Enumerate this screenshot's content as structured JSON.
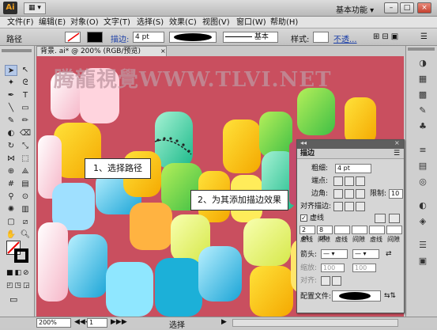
{
  "titlebar": {
    "app_logo": "Ai",
    "workspace_label": "基本功能 ▾",
    "min": "–",
    "max": "□",
    "close": "×"
  },
  "menubar": {
    "items": [
      "文件(F)",
      "编辑(E)",
      "对象(O)",
      "文字(T)",
      "选择(S)",
      "效果(C)",
      "视图(V)",
      "窗口(W)",
      "帮助(H)"
    ]
  },
  "control": {
    "object_label": "路径",
    "stroke_label": "描边:",
    "stroke_weight": "4 pt",
    "brush_label": "基本",
    "style_label": "样式:",
    "opacity_label": "不透..."
  },
  "document": {
    "tab_title": "背景. ai* @ 200% (RGB/预览)"
  },
  "canvas": {
    "watermark": "腾龍視覺WWW.TLVI.NET",
    "callout1": "1、选择路径",
    "callout2": "2、为其添加描边效果"
  },
  "stroke_panel": {
    "title": "描边",
    "weight_label": "粗细:",
    "weight_value": "4 pt",
    "cap_label": "端点:",
    "corner_label": "边角:",
    "limit_label": "限制:",
    "limit_value": "10",
    "align_label": "对齐描边:",
    "dashed_label": "虚线",
    "dash_values": [
      "2 pt",
      "8 pt",
      "",
      "",
      "",
      ""
    ],
    "dash_headers": [
      "虚线",
      "间隙",
      "虚线",
      "间隙",
      "虚线",
      "间隙"
    ],
    "arrow_label": "箭头:",
    "scale_label": "缩放:",
    "scale1": "100",
    "scale2": "100",
    "align2_label": "对齐:",
    "profile_label": "配置文件:"
  },
  "status": {
    "zoom": "200%",
    "page": "1",
    "mode": "选择"
  },
  "colors": {
    "canvas_bg": "#c94f5f",
    "accent_orange": "#f0a020"
  }
}
